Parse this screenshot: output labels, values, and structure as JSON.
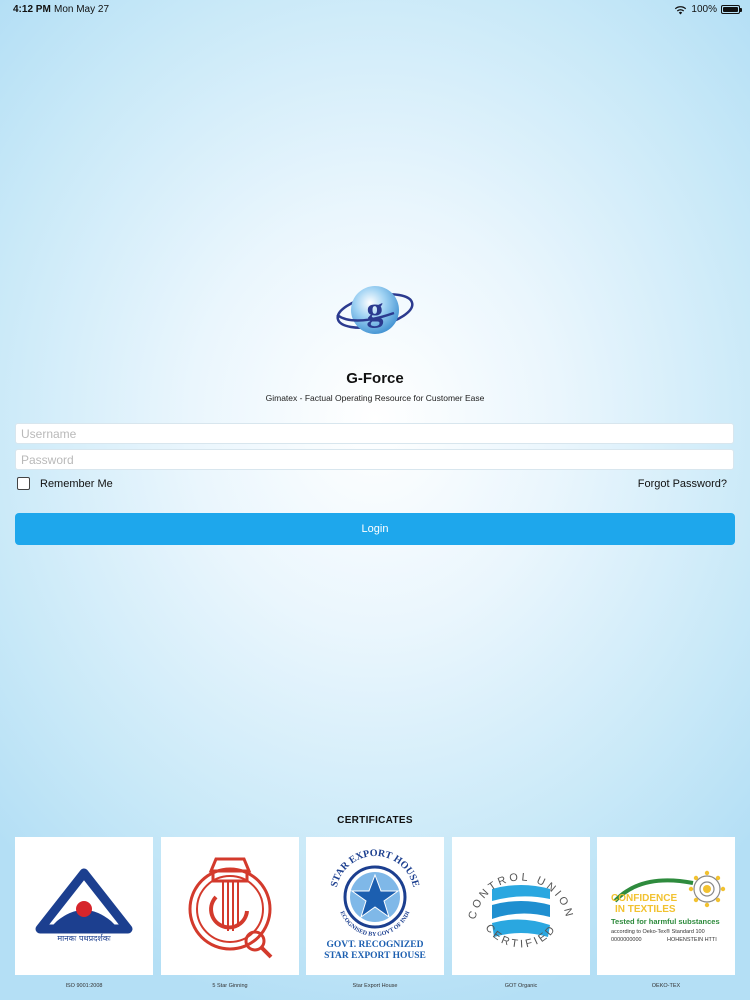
{
  "status_bar": {
    "time": "4:12 PM",
    "date": "Mon May 27",
    "battery": "100%",
    "battery_level": 1.0
  },
  "app": {
    "logo_letter": "g",
    "title": "G-Force",
    "subtitle": "Gimatex - Factual Operating Resource for Customer Ease"
  },
  "login_form": {
    "username_placeholder": "Username",
    "password_placeholder": "Password",
    "remember_label": "Remember Me",
    "remember_checked": false,
    "forgot_label": "Forgot Password?",
    "login_label": "Login"
  },
  "certificates": {
    "heading": "CERTIFICATES",
    "items": [
      {
        "label": "ISO 9001:2008",
        "icon": "bis-isi-mark",
        "logo_text": "मानकः पथप्रदर्शकः"
      },
      {
        "label": "5 Star Ginning",
        "icon": "star-ginning-mark"
      },
      {
        "label": "Star Export House",
        "icon": "star-export-house-seal",
        "logo_text": "STAR EXPORT HOUSE",
        "logo_subtext": "RECOGNISED BY GOVT OF INDIA",
        "logo_caption1": "GOVT. RECOGNIZED",
        "logo_caption2": "STAR EXPORT HOUSE"
      },
      {
        "label": "GOT Organic",
        "icon": "control-union-logo",
        "logo_text_top": "CONTROL UNION",
        "logo_text_bottom": "CERTIFIED"
      },
      {
        "label": "OEKO-TEX",
        "icon": "oeko-tex-logo",
        "logo_line1": "CONFIDENCE",
        "logo_line2": "IN TEXTILES",
        "logo_line3": "Tested for harmful substances",
        "logo_line4": "according to Oeko-Tex® Standard 100",
        "logo_line5": "0000000000",
        "logo_line6": "HOHENSTEIN HTTI"
      }
    ]
  },
  "colors": {
    "accent": "#1ea7ec",
    "background": "#c9e9f8",
    "logo_blue": "#2b3a8f"
  }
}
